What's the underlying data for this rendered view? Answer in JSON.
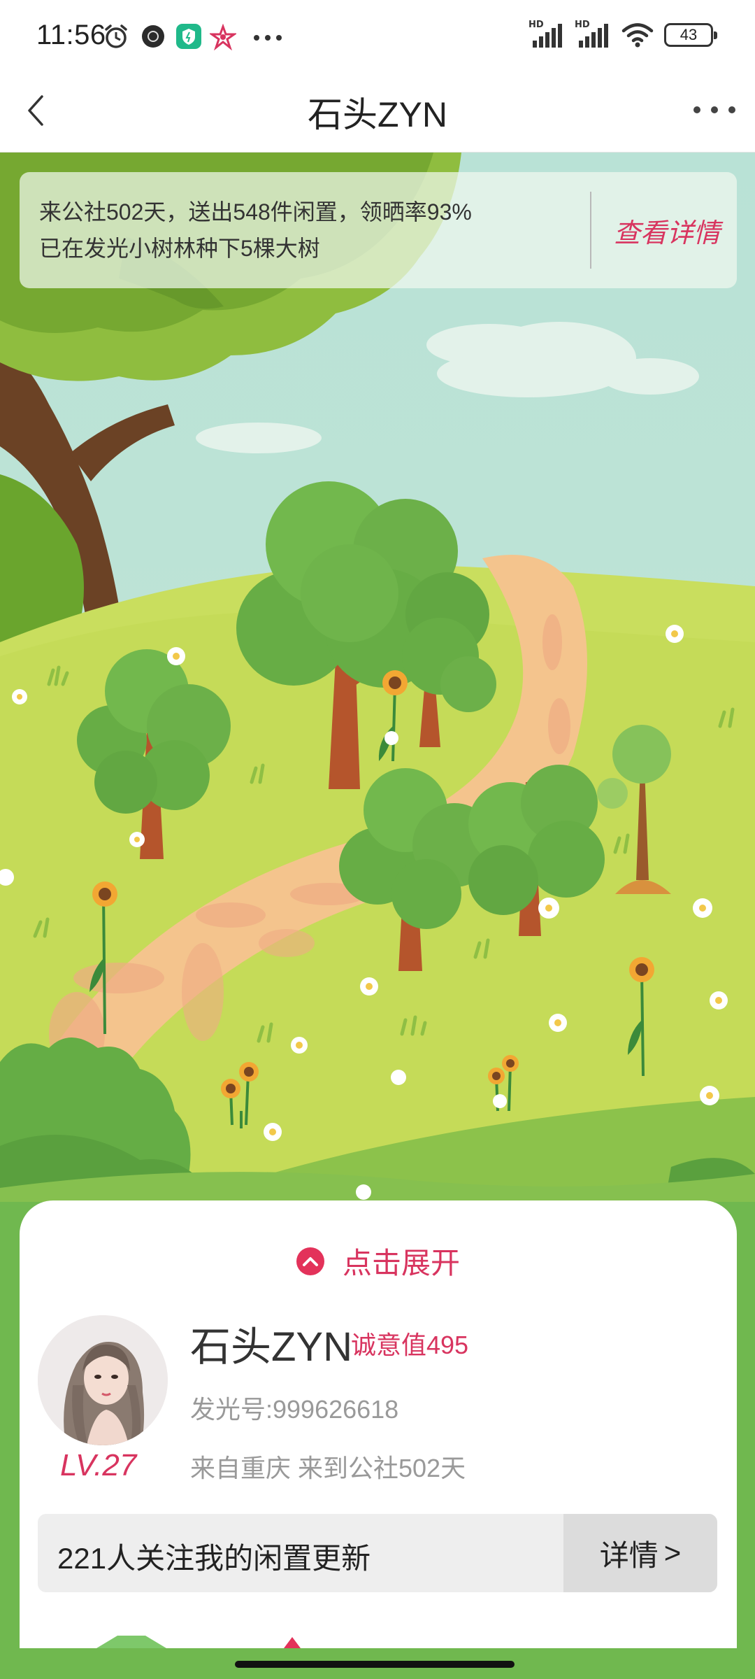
{
  "status_bar": {
    "time": "11:56",
    "notification_icons": [
      "alarm-icon",
      "dark-app-icon",
      "shield-app-icon",
      "star-app-icon",
      "more-dots-icon"
    ],
    "network_labels": [
      "HD",
      "HD"
    ],
    "battery_level": "43"
  },
  "nav": {
    "title": "石头ZYN",
    "back_icon": "chevron-left-icon",
    "more_icon": "more-dots-icon"
  },
  "stats": {
    "line1": "来公社502天，送出548件闲置，领晒率93%",
    "line2": "已在发光小树林种下5棵大树",
    "detail_label": "查看详情"
  },
  "profile": {
    "expand_label": "点击展开",
    "name": "石头ZYN",
    "sincerity": "诚意值495",
    "level": "LV.27",
    "user_id": "发光号:999626618",
    "origin": "来自重庆 来到公社502天"
  },
  "follow": {
    "text": "221人关注我的闲置更新",
    "detail_label": "详情",
    "detail_arrow": ">"
  },
  "colors": {
    "accent": "#d8345f",
    "sky": "#bfe3d4",
    "grass": "#c9de5e",
    "path": "#f4c48d"
  }
}
